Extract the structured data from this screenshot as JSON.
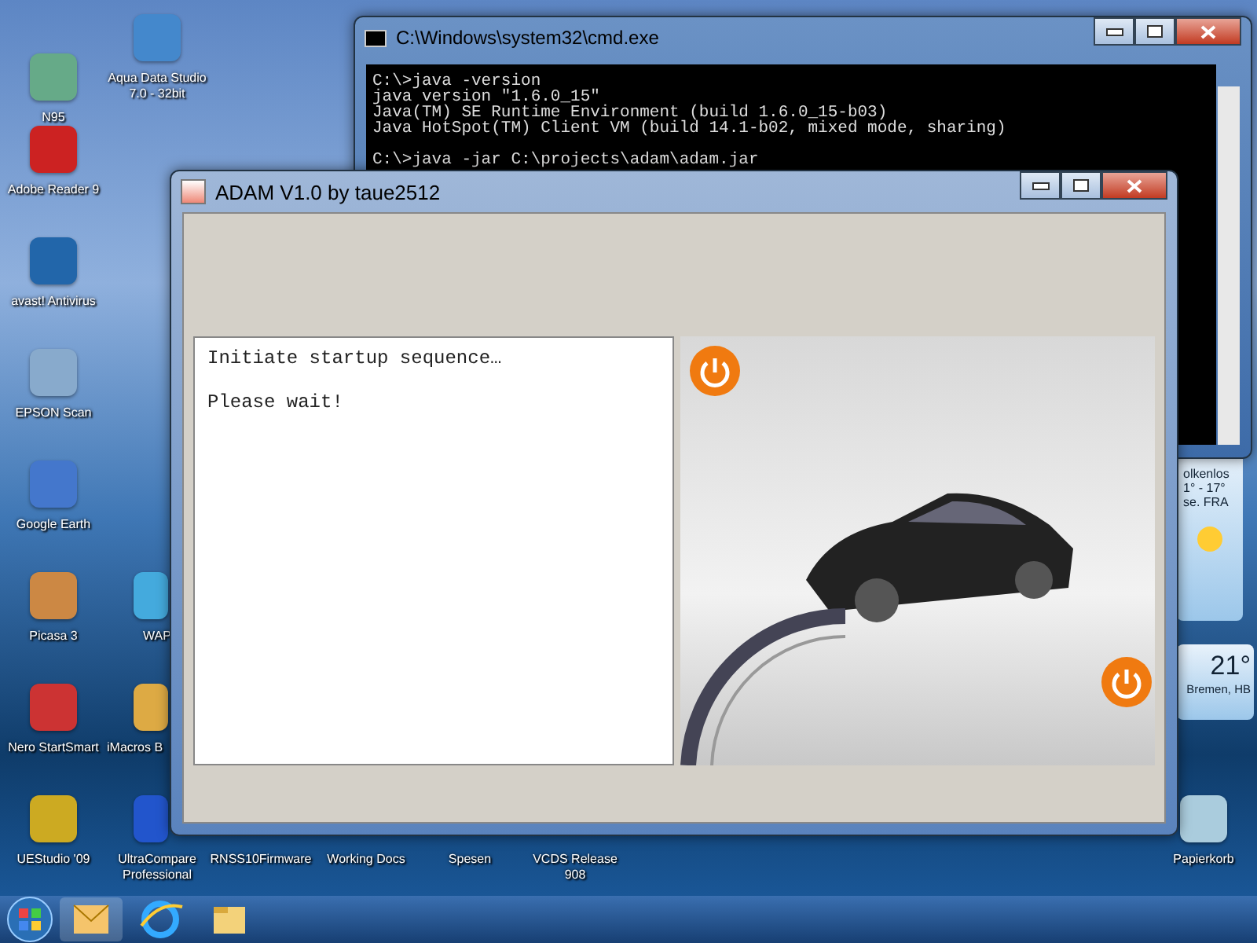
{
  "desktop": {
    "icons": [
      {
        "label": "N95"
      },
      {
        "label": "Aqua Data Studio 7.0 - 32bit"
      },
      {
        "label": "Adobe Reader 9"
      },
      {
        "label": "avast! Antivirus"
      },
      {
        "label": "EPSON Scan"
      },
      {
        "label": "Google Earth"
      },
      {
        "label": "Picasa 3"
      },
      {
        "label": "WAP"
      },
      {
        "label": "Nero StartSmart"
      },
      {
        "label": "iMacros B"
      },
      {
        "label": "UEStudio '09"
      },
      {
        "label": "UltraCompare Professional"
      },
      {
        "label": "RNSS10Firmware"
      },
      {
        "label": "Working Docs"
      },
      {
        "label": "Spesen"
      },
      {
        "label": "VCDS Release 908"
      },
      {
        "label": "Papierkorb"
      }
    ]
  },
  "gadgets": [
    {
      "lines": [
        "olkenlos",
        "1° - 17°",
        "se. FRA"
      ]
    },
    {
      "temperature": "21°",
      "place": "Bremen, HB"
    }
  ],
  "console": {
    "title": "C:\\Windows\\system32\\cmd.exe",
    "blocks": [
      [
        "C:\\>java -version",
        "java version \"1.6.0_15\"",
        "Java(TM) SE Runtime Environment (build 1.6.0_15-b03)",
        "Java HotSpot(TM) Client VM (build 14.1-b02, mixed mode, sharing)"
      ],
      [
        "C:\\>java -jar C:\\projects\\adam\\adam.jar"
      ]
    ]
  },
  "app": {
    "title": "ADAM V1.0 by taue2512",
    "log": [
      [
        "Initiate startup sequence…"
      ],
      [
        "Please wait!"
      ]
    ]
  }
}
